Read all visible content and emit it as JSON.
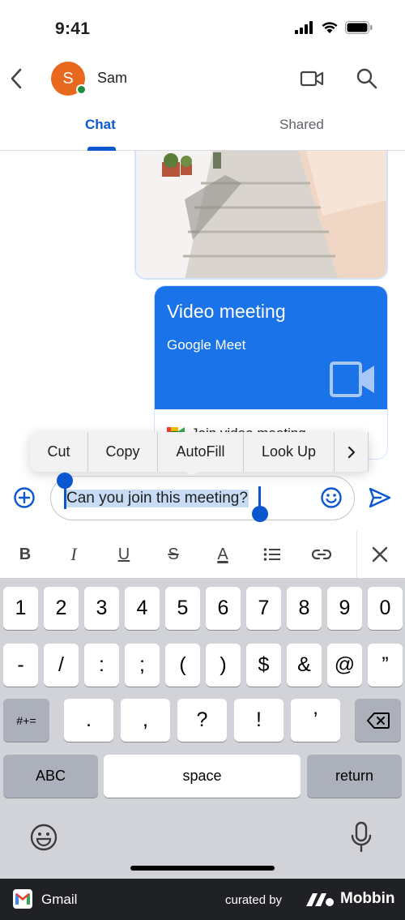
{
  "status_bar": {
    "time": "9:41"
  },
  "header": {
    "contact_name": "Sam",
    "avatar_initial": "S"
  },
  "tabs": [
    {
      "label": "Chat",
      "active": true
    },
    {
      "label": "Shared",
      "active": false
    }
  ],
  "meet_card": {
    "title": "Video meeting",
    "subtitle": "Google Meet",
    "footer_text": "Join video meeting"
  },
  "context_menu": {
    "items": [
      "Cut",
      "Copy",
      "AutoFill",
      "Look Up"
    ],
    "more": ">"
  },
  "compose": {
    "text": "Can you join this meeting?"
  },
  "format_bar": {
    "bold": "B",
    "italic": "I",
    "underline": "U",
    "strike": "S",
    "text_color": "A"
  },
  "keyboard": {
    "row1": [
      "1",
      "2",
      "3",
      "4",
      "5",
      "6",
      "7",
      "8",
      "9",
      "0"
    ],
    "row2": [
      "-",
      "/",
      ":",
      ";",
      "(",
      ")",
      "$",
      "&",
      "@",
      "”"
    ],
    "row3": [
      ".",
      ",",
      "?",
      "!",
      "’"
    ],
    "symbols_key": "#+=",
    "abc_key": "ABC",
    "space_key": "space",
    "return_key": "return"
  },
  "footer": {
    "app": "Gmail",
    "curated_by": "curated by",
    "brand": "Mobbin"
  },
  "colors": {
    "accent": "#0b57d0",
    "meet_blue": "#1a73e8",
    "avatar": "#e8681e",
    "presence": "#1e8e3e"
  }
}
